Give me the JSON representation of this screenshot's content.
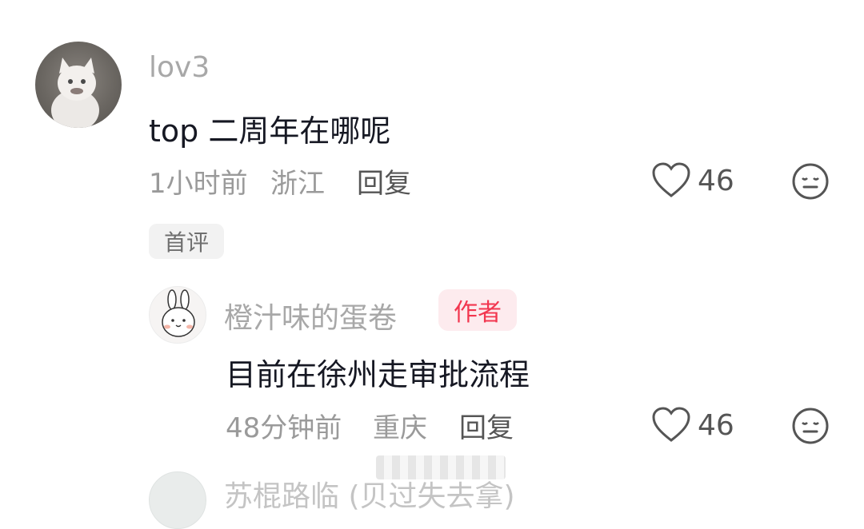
{
  "comments": [
    {
      "username": "lov3",
      "text": "top 二周年在哪呢",
      "time": "1小时前",
      "location": "浙江",
      "reply_label": "回复",
      "likes": "46",
      "badge": "首评",
      "avatar_icon": "cat-avatar",
      "reply": {
        "username": "橙汁味的蛋卷",
        "author_badge": "作者",
        "text": "目前在徐州走审批流程",
        "time": "48分钟前",
        "location": "重庆",
        "reply_label": "回复",
        "likes": "46",
        "avatar_icon": "bunny-avatar"
      }
    },
    {
      "username_partial": "苏棍路临 (贝过失去拿)"
    }
  ],
  "icons": {
    "like": "heart-outline-icon",
    "dislike": "neutral-face-icon"
  },
  "colors": {
    "author_badge_text": "#f2364f",
    "author_badge_bg": "#fdebee",
    "username": "#a8a8a8",
    "body_text": "#161823"
  }
}
